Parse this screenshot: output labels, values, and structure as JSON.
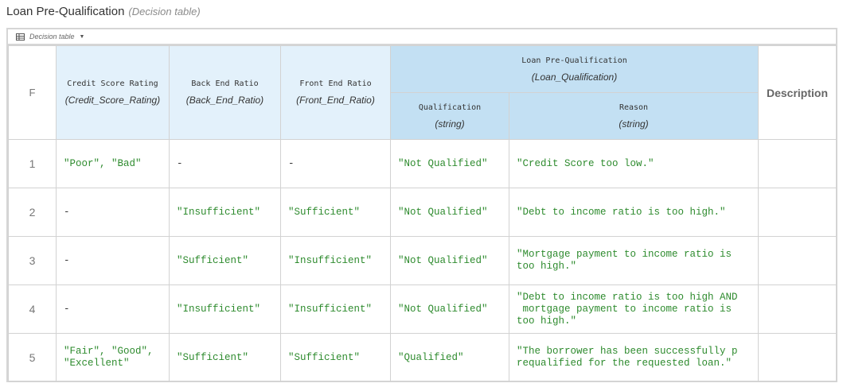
{
  "title": {
    "name": "Loan Pre-Qualification",
    "type": "(Decision table)"
  },
  "toolbar": {
    "icon": "table-icon",
    "label": "Decision table",
    "caret": "▼"
  },
  "table": {
    "hit_policy": "F",
    "inputs": [
      {
        "name": "Credit Score Rating",
        "type": "(Credit_Score_Rating)"
      },
      {
        "name": "Back End Ratio",
        "type": "(Back_End_Ratio)"
      },
      {
        "name": "Front End Ratio",
        "type": "(Front_End_Ratio)"
      }
    ],
    "output": {
      "name": "Loan Pre-Qualification",
      "type": "(Loan_Qualification)",
      "columns": [
        {
          "name": "Qualification",
          "type": "(string)"
        },
        {
          "name": "Reason",
          "type": "(string)"
        }
      ]
    },
    "description_header": "Description",
    "rules": [
      {
        "num": "1",
        "cells": [
          "\"Poor\", \"Bad\"",
          "-",
          "-",
          "\"Not Qualified\"",
          "\"Credit Score too low.\""
        ],
        "description": ""
      },
      {
        "num": "2",
        "cells": [
          "-",
          "\"Insufficient\"",
          "\"Sufficient\"",
          "\"Not Qualified\"",
          "\"Debt to income ratio is too high.\""
        ],
        "description": ""
      },
      {
        "num": "3",
        "cells": [
          "-",
          "\"Sufficient\"",
          "\"Insufficient\"",
          "\"Not Qualified\"",
          "\"Mortgage payment to income ratio is\ntoo high.\""
        ],
        "description": ""
      },
      {
        "num": "4",
        "cells": [
          "-",
          "\"Insufficient\"",
          "\"Insufficient\"",
          "\"Not Qualified\"",
          "\"Debt to income ratio is too high AND\n mortgage payment to income ratio is\ntoo high.\""
        ],
        "description": ""
      },
      {
        "num": "5",
        "cells": [
          "\"Fair\", \"Good\",\n\"Excellent\"",
          "\"Sufficient\"",
          "\"Sufficient\"",
          "\"Qualified\"",
          "\"The borrower has been successfully p\nrequalified for the requested loan.\""
        ],
        "description": ""
      }
    ]
  },
  "colors": {
    "input_header": "#e3f1fb",
    "output_header": "#c3e0f3",
    "string_value": "#2e8b2e",
    "border": "#d2d2d2"
  }
}
